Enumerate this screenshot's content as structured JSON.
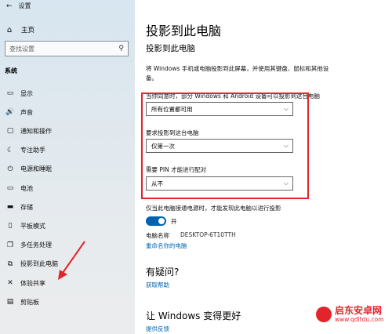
{
  "window": {
    "back_glyph": "←",
    "title": "设置"
  },
  "sidebar": {
    "home_label": "主页",
    "search_placeholder": "查找设置",
    "section": "系统",
    "items": [
      {
        "icon": "display-icon",
        "glyph": "▭",
        "label": "显示"
      },
      {
        "icon": "sound-icon",
        "glyph": "🔊",
        "label": "声音"
      },
      {
        "icon": "notification-icon",
        "glyph": "▢",
        "label": "通知和操作"
      },
      {
        "icon": "focus-assist-icon",
        "glyph": "☾",
        "label": "专注助手"
      },
      {
        "icon": "power-icon",
        "glyph": "⏻",
        "label": "电源和睡眠"
      },
      {
        "icon": "battery-icon",
        "glyph": "▭",
        "label": "电池"
      },
      {
        "icon": "storage-icon",
        "glyph": "▬",
        "label": "存储"
      },
      {
        "icon": "tablet-icon",
        "glyph": "▯",
        "label": "平板模式"
      },
      {
        "icon": "multitasking-icon",
        "glyph": "❐",
        "label": "多任务处理"
      },
      {
        "icon": "projecting-icon",
        "glyph": "⧉",
        "label": "投影到此电脑"
      },
      {
        "icon": "shared-experiences-icon",
        "glyph": "✕",
        "label": "体验共享"
      },
      {
        "icon": "clipboard-icon",
        "glyph": "▤",
        "label": "剪贴板"
      }
    ]
  },
  "main": {
    "title": "投影到此电脑",
    "subtitle": "投影到此电脑",
    "description": "将 Windows 手机或电脑投影到此屏幕，并使用其键盘、鼠标和其他设备。",
    "setting1_label": "当你同意时，部分 Windows 和 Android 设备可以投影到这台电脑",
    "setting1_value": "所有位置都可用",
    "setting2_label": "要求投影到这台电脑",
    "setting2_value": "仅第一次",
    "setting3_label": "需要 PIN 才能进行配对",
    "setting3_value": "从不",
    "power_label": "仅当此电脑接通电源时，才能发现此电脑以进行投影",
    "toggle_state": "开",
    "toggle_on": true,
    "pc_name_label": "电脑名称",
    "pc_name_value": "DESKTOP-6T10TTH",
    "rename_link": "重命名你的电脑",
    "help_heading": "有疑问?",
    "help_link": "获取帮助",
    "improve_heading": "让 Windows 变得更好",
    "feedback_link": "提供反馈"
  },
  "watermark": {
    "title": "启东安卓网",
    "url": "www.qdltdu.com"
  },
  "colors": {
    "accent": "#0063b1",
    "annotation_red": "#e3242b"
  }
}
